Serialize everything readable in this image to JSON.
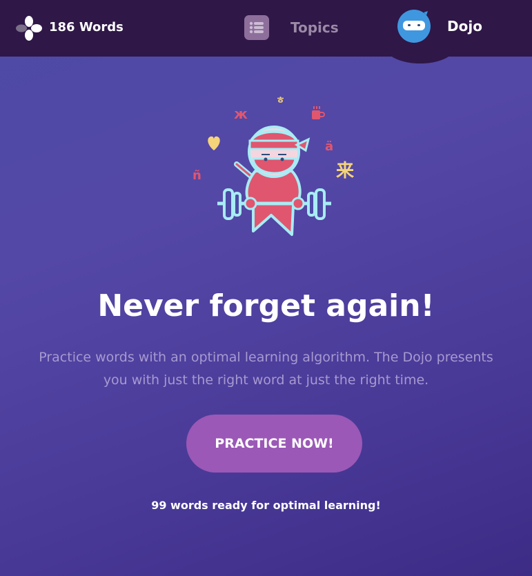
{
  "header": {
    "word_count": "186 Words",
    "logo_icon": "app-logo",
    "tabs": [
      {
        "label": "Topics",
        "icon": "list-icon",
        "active": false
      },
      {
        "label": "Dojo",
        "icon": "ninja-avatar-icon",
        "active": true
      }
    ]
  },
  "hero": {
    "illustration": "ninja-lifting-barbell",
    "floating_glyphs": [
      "ж",
      "ㅎ",
      "ä",
      "ñ",
      "来"
    ],
    "floating_icons": [
      "heart-icon",
      "coffee-cup-icon"
    ]
  },
  "main": {
    "headline": "Never forget again!",
    "description": "Practice words with an optimal learning algorithm. The Dojo presents you with just the right word at just the right time.",
    "cta_label": "PRACTICE NOW!",
    "ready_text": "99 words ready for optimal learning!"
  },
  "colors": {
    "topbar": "#2f1747",
    "accent_button": "#9b58b6",
    "ninja_red": "#e0566f",
    "outline_cyan": "#a8ecf5",
    "glyph_yellow": "#f5d47a"
  }
}
